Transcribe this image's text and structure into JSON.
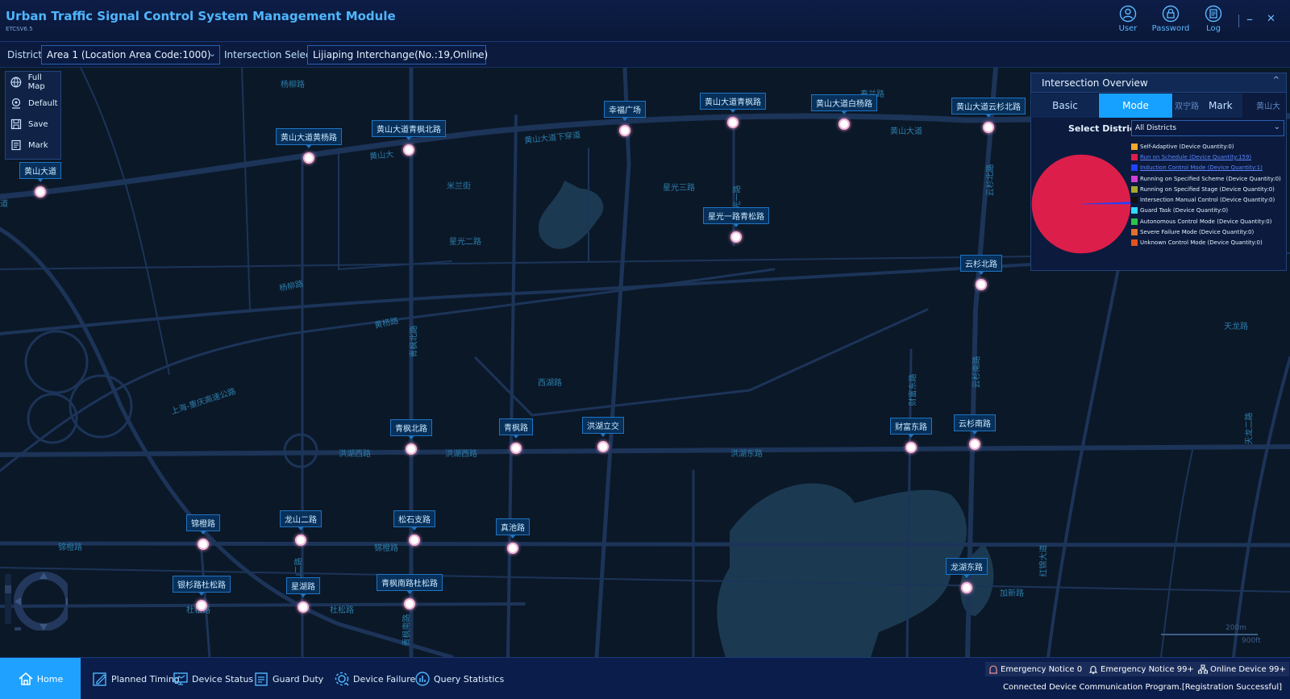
{
  "app": {
    "title": "Urban Traffic Signal Control System Management Module",
    "version": "ETCSV6.5"
  },
  "top_actions": [
    {
      "label": "User",
      "icon": "user-icon"
    },
    {
      "label": "Password",
      "icon": "password-icon"
    },
    {
      "label": "Log",
      "icon": "log-icon"
    }
  ],
  "window": {
    "minimize": "–",
    "close": "✕"
  },
  "toolbar": {
    "district_label": "District",
    "district_value": "Area 1  (Location Area Code:1000)",
    "intersection_label": "Intersection Select",
    "intersection_value": "Lijiaping Interchange(No.:19,Online)"
  },
  "map_tools": [
    {
      "label": "Full Map",
      "icon": "globe-icon"
    },
    {
      "label": "Default",
      "icon": "location-icon"
    },
    {
      "label": "Save",
      "icon": "save-icon"
    },
    {
      "label": "Mark",
      "icon": "mark-icon"
    }
  ],
  "intersections": [
    {
      "name": "黄山大道"
    },
    {
      "name": "黄山大道黄杨路"
    },
    {
      "name": "黄山大道青枫北路"
    },
    {
      "name": "幸福广场"
    },
    {
      "name": "黄山大道青枫路"
    },
    {
      "name": "黄山大道白杨路"
    },
    {
      "name": "黄山大道云杉北路"
    },
    {
      "name": "星光一路青松路"
    },
    {
      "name": "云杉北路"
    },
    {
      "name": "青枫北路"
    },
    {
      "name": "青枫路"
    },
    {
      "name": "洪湖立交"
    },
    {
      "name": "财富东路"
    },
    {
      "name": "云杉南路"
    },
    {
      "name": "锦橙路"
    },
    {
      "name": "龙山二路"
    },
    {
      "name": "松石支路"
    },
    {
      "name": "真池路"
    },
    {
      "name": "龙湖东路"
    },
    {
      "name": "银杉路杜松路"
    },
    {
      "name": "星湖路"
    },
    {
      "name": "青枫南路杜松路"
    }
  ],
  "road_labels": [
    "杨柳路",
    "春兰路",
    "黄山大道下穿道",
    "黄山大道",
    "黄山大",
    "米兰街",
    "星光三路",
    "星光二路",
    "杨柳路",
    "黄杨路",
    "上海-重庆高速公路",
    "西湖路",
    "洪湖西路",
    "洪湖西路",
    "洪湖东路",
    "锦橙路",
    "锦橙路",
    "杜松路",
    "杜松路",
    "天龙路",
    "加新路",
    "天龙二路",
    "青枫北路",
    "云杉南路",
    "红锦大道",
    "云杉北路",
    "财富东路",
    "龙山二路",
    "道",
    "青枫南路",
    "星光一路"
  ],
  "scale": {
    "top": "200m",
    "bottom": "900ft"
  },
  "overview": {
    "title": "Intersection Overview",
    "collapse": "^",
    "tabs": [
      "Basic",
      "Mode",
      "Mark"
    ],
    "active_tab": "Mode",
    "ghost_text_left": "双宁路",
    "ghost_text_right": "黄山大",
    "district_label": "Select District:",
    "district_value": "All Districts"
  },
  "chart_data": {
    "type": "pie",
    "categories": [
      "Self-Adaptive (Device Quantity:0)",
      "Run on Schedule (Device Quantity:159)",
      "Induction Control Mode (Device Quantity:1)",
      "Running on Specified Scheme (Device Quantity:0)",
      "Running on Specified Stage (Device Quantity:0)",
      "Intersection Manual Control (Device Quantity:0)",
      "Guard Task (Device Quantity:0)",
      "Autonomous Control Mode (Device Quantity:0)",
      "Severe Failure Mode (Device Quantity:0)",
      "Unknown Control Mode (Device Quantity:0)"
    ],
    "values": [
      0,
      159,
      1,
      0,
      0,
      0,
      0,
      0,
      0,
      0
    ],
    "colors": [
      "#f2a82b",
      "#dc1f4a",
      "#2142ff",
      "#d33fd3",
      "#a8a82c",
      "#101010",
      "#2fd9ff",
      "#2cc24a",
      "#e0702c",
      "#e0531f"
    ],
    "legend": "right"
  },
  "bottom_nav": [
    {
      "label": "Home",
      "icon": "home-icon"
    },
    {
      "label": "Planned Timing",
      "icon": "edit-icon"
    },
    {
      "label": "Device Status",
      "icon": "monitor-icon"
    },
    {
      "label": "Guard Duty",
      "icon": "clipboard-icon"
    },
    {
      "label": "Device Failure",
      "icon": "gear-icon"
    },
    {
      "label": "Query Statistics",
      "icon": "chart-icon"
    }
  ],
  "status": {
    "badges": [
      {
        "label": "Emergency Notice 0",
        "icon": "emergency-icon"
      },
      {
        "label": "Emergency Notice 99+",
        "icon": "bell-icon"
      },
      {
        "label": "Online Device 99+",
        "icon": "network-icon"
      }
    ],
    "connection": "Connected Device Communication Program.[Registration Successful]"
  }
}
